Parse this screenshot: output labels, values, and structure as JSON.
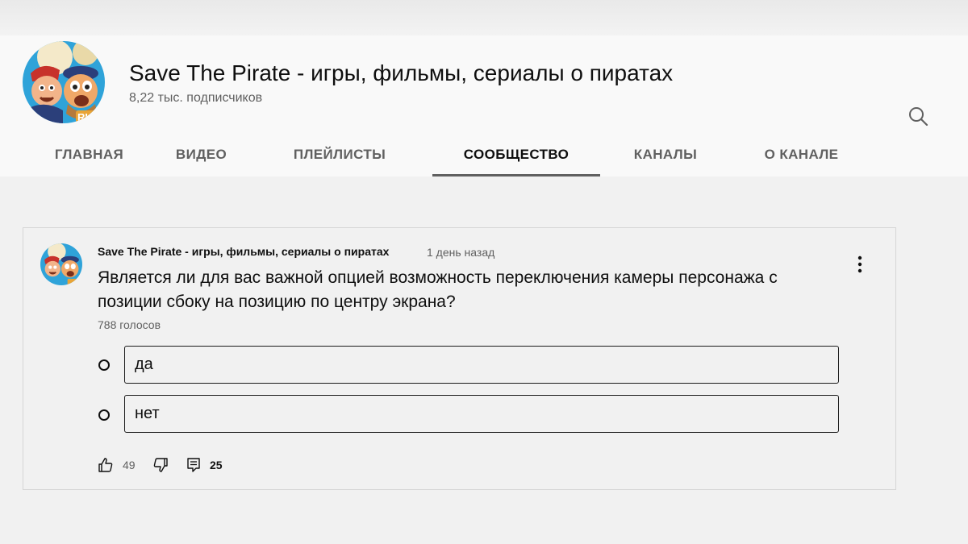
{
  "channel": {
    "name": "Save The Pirate - игры, фильмы, сериалы о пиратах",
    "subscribers": "8,22 тыс. подписчиков",
    "avatar_icon": "pirate-avatar-icon"
  },
  "tabs": [
    {
      "label": "ГЛАВНАЯ",
      "active": false
    },
    {
      "label": "ВИДЕО",
      "active": false
    },
    {
      "label": "ПЛЕЙЛИСТЫ",
      "active": false
    },
    {
      "label": "СООБЩЕСТВО",
      "active": true
    },
    {
      "label": "КАНАЛЫ",
      "active": false
    },
    {
      "label": "О КАНАЛЕ",
      "active": false
    }
  ],
  "search_icon": "search-icon",
  "post": {
    "author": "Save The Pirate - игры, фильмы, сериалы о пиратах",
    "time": "1 день назад",
    "text": "Является ли для вас важной опцией возможность переключения камеры персонажа с позиции сбоку на позицию по центру экрана?",
    "votes": "788 голосов",
    "options": [
      "да",
      "нет"
    ],
    "likes": "49",
    "comments": "25",
    "icons": {
      "menu": "more-vert-icon",
      "like": "thumb-up-icon",
      "dislike": "thumb-down-icon",
      "comment": "comment-icon"
    }
  },
  "colors": {
    "page_bg": "#f1f1f1",
    "header_bg": "#f9f9f9",
    "text_primary": "#0f0f0f",
    "text_secondary": "#606060",
    "avatar_bg": "#2fa3d9"
  }
}
